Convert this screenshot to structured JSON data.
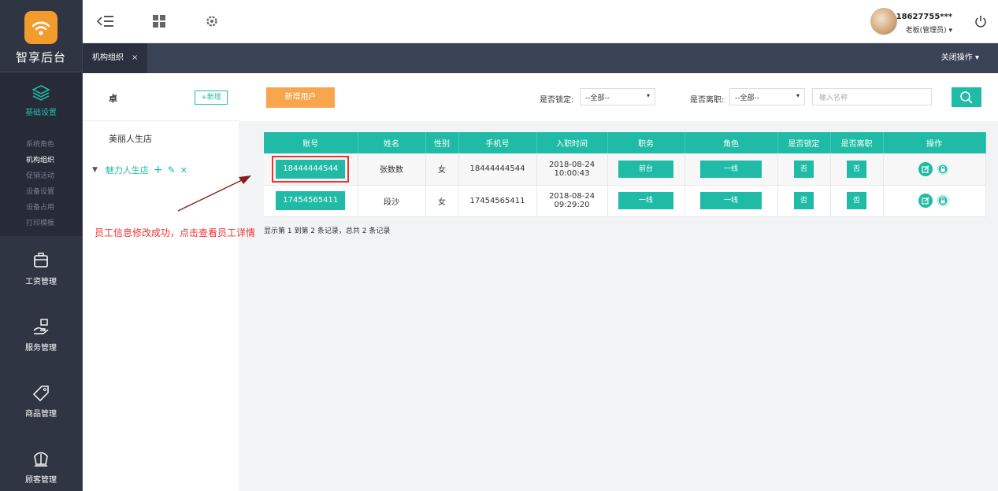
{
  "app": {
    "logo_text": "智享后台"
  },
  "sidebar": {
    "basic_label": "基础设置",
    "sub_items": [
      "系统角色",
      "机构组织",
      "促销活动",
      "设备设置",
      "设备占用",
      "打印模板"
    ],
    "active_sub_index": 1,
    "main_items": [
      {
        "label": "工资管理",
        "icon": "briefcase-icon"
      },
      {
        "label": "服务管理",
        "icon": "hand-service-icon"
      },
      {
        "label": "商品管理",
        "icon": "sale-tag-icon"
      },
      {
        "label": "顾客管理",
        "icon": "crown-icon"
      }
    ]
  },
  "topbar": {
    "username": "18627755***",
    "role": "老板(管理员)",
    "icons": [
      "menu-collapse-icon",
      "grid-icon",
      "gear-icon",
      "power-icon"
    ]
  },
  "tabs": {
    "active_tab": "机构组织",
    "close_glyph": "×",
    "close_ops": "关闭操作"
  },
  "org": {
    "title": "卓",
    "add_label": "+新增",
    "items": [
      "美丽人生店",
      "魅力人生店"
    ],
    "action_glyphs": [
      "+",
      "✎",
      "✕"
    ]
  },
  "filters": {
    "add_user": "新增用户",
    "lock_label": "是否锁定:",
    "lock_value": "--全部--",
    "leave_label": "是否离职:",
    "leave_value": "--全部--",
    "search_placeholder": "输入名称"
  },
  "table": {
    "headers": [
      "账号",
      "姓名",
      "性别",
      "手机号",
      "入职时间",
      "职务",
      "角色",
      "是否锁定",
      "是否离职",
      "操作"
    ],
    "rows": [
      {
        "account": "18444444544",
        "name": "张数数",
        "gender": "女",
        "phone": "18444444544",
        "hire_date": "2018-08-24",
        "hire_time": "10:00:43",
        "position": "前台",
        "role": "一线",
        "locked": "否",
        "left": "否"
      },
      {
        "account": "17454565411",
        "name": "段沙",
        "gender": "女",
        "phone": "17454565411",
        "hire_date": "2018-08-24",
        "hire_time": "09:29:20",
        "position": "一线",
        "role": "一线",
        "locked": "否",
        "left": "否"
      }
    ],
    "pager": "显示第 1 到第 2 条记录，总共 2 条记录"
  },
  "annotation": "员工信息修改成功，点击查看员工详情",
  "colors": {
    "accent": "#1fbba6",
    "orange": "#f7a64d",
    "sidebar": "#2f3543",
    "alert": "#e33333"
  }
}
